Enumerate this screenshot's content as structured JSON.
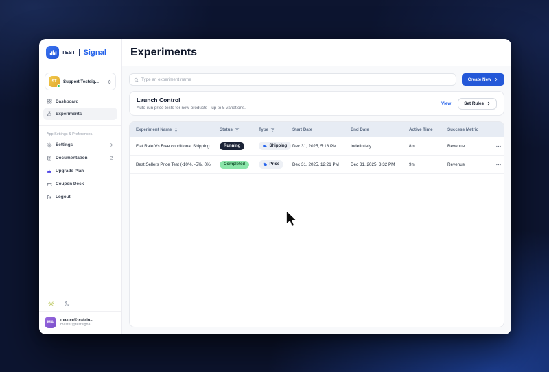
{
  "brand": {
    "left": "TEST",
    "right": "Signal"
  },
  "sidebar": {
    "workspace": {
      "initials": "ST",
      "name": "Support Testsig..."
    },
    "nav": [
      {
        "label": "Dashboard"
      },
      {
        "label": "Experiments"
      }
    ],
    "section_label": "App Settings & Preferences.",
    "items": [
      {
        "label": "Settings"
      },
      {
        "label": "Documentation"
      },
      {
        "label": "Upgrade Plan"
      },
      {
        "label": "Coupon Deck"
      },
      {
        "label": "Logout"
      }
    ],
    "user": {
      "initials": "MA",
      "line1": "master@testsig...",
      "line2": "master@testsigna..."
    }
  },
  "header": {
    "title": "Experiments"
  },
  "toolbar": {
    "search_placeholder": "Type an experiment name",
    "create_label": "Create New"
  },
  "launch_control": {
    "title": "Launch Control",
    "subtitle": "Auto-run price tests for new products—up to 5 variations.",
    "view_label": "View",
    "set_rules_label": "Set Rules"
  },
  "table": {
    "columns": [
      "Experiment Name",
      "Status",
      "Type",
      "Start Date",
      "End Date",
      "Active Time",
      "Success Metric"
    ],
    "rows": [
      {
        "name": "Flat Rate Vs Free conditional Shipping",
        "status": "Running",
        "type": "Shipping",
        "start": "Dec 31, 2025, 5:18 PM",
        "end": "Indefinitely",
        "active": "8m",
        "metric": "Revenue"
      },
      {
        "name": "Best Sellers Price Test (-10%, -5%, 0%,",
        "status": "Completed",
        "type": "Price",
        "start": "Dec 31, 2025, 12:21 PM",
        "end": "Dec 31, 2025, 3:32 PM",
        "active": "9m",
        "metric": "Revenue"
      }
    ]
  },
  "colors": {
    "accent_blue": "#2563eb",
    "running_badge": "#1b2336",
    "completed_badge": "#8be6aa",
    "table_header_bg": "#e7ecf4",
    "background_navy": "#0d1530"
  }
}
